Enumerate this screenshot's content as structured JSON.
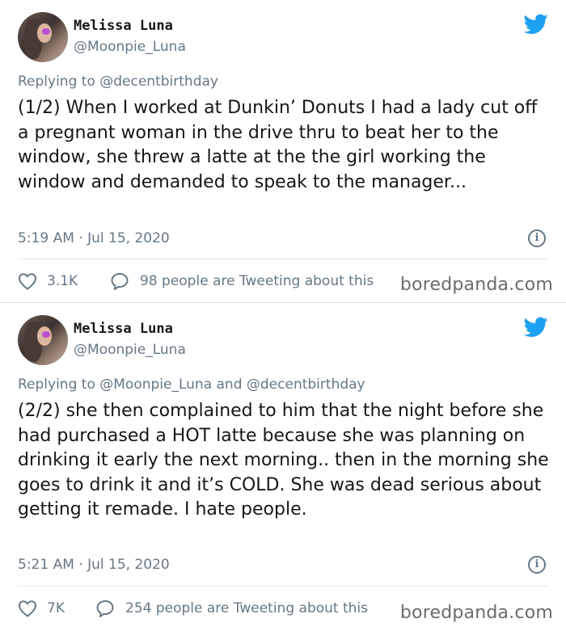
{
  "tweets": [
    {
      "display_name": "Melissa Luna",
      "handle": "@Moonpie_Luna",
      "replying_prefix": "Replying to",
      "replying_to": "@decentbirthday",
      "text": "(1/2) When I worked at Dunkin’ Donuts I had a lady cut off a pregnant woman in the drive thru to beat her to the window, she threw a latte at the the girl working the window and demanded to speak to the manager...",
      "timestamp": "5:19 AM · Jul 15, 2020",
      "likes": "3.1K",
      "people_tweeting": "98 people are Tweeting about this"
    },
    {
      "display_name": "Melissa Luna",
      "handle": "@Moonpie_Luna",
      "replying_prefix": "Replying to",
      "replying_to": "@Moonpie_Luna and @decentbirthday",
      "text": "(2/2) she then complained to him that the night before she had purchased a HOT latte because she was planning on drinking it early the next morning.. then in the morning she goes to drink it and it’s COLD. She was dead serious about getting it remade. I hate people.",
      "timestamp": "5:21 AM · Jul 15, 2020",
      "likes": "7K",
      "people_tweeting": "254 people are Tweeting about this"
    }
  ],
  "watermark": "boredpanda.com",
  "colors": {
    "twitter_blue": "#1da1f2",
    "secondary_text": "#657786",
    "primary_text": "#14171a"
  },
  "icons": [
    "twitter-bird-icon",
    "info-icon",
    "heart-icon",
    "speech-bubble-icon"
  ]
}
